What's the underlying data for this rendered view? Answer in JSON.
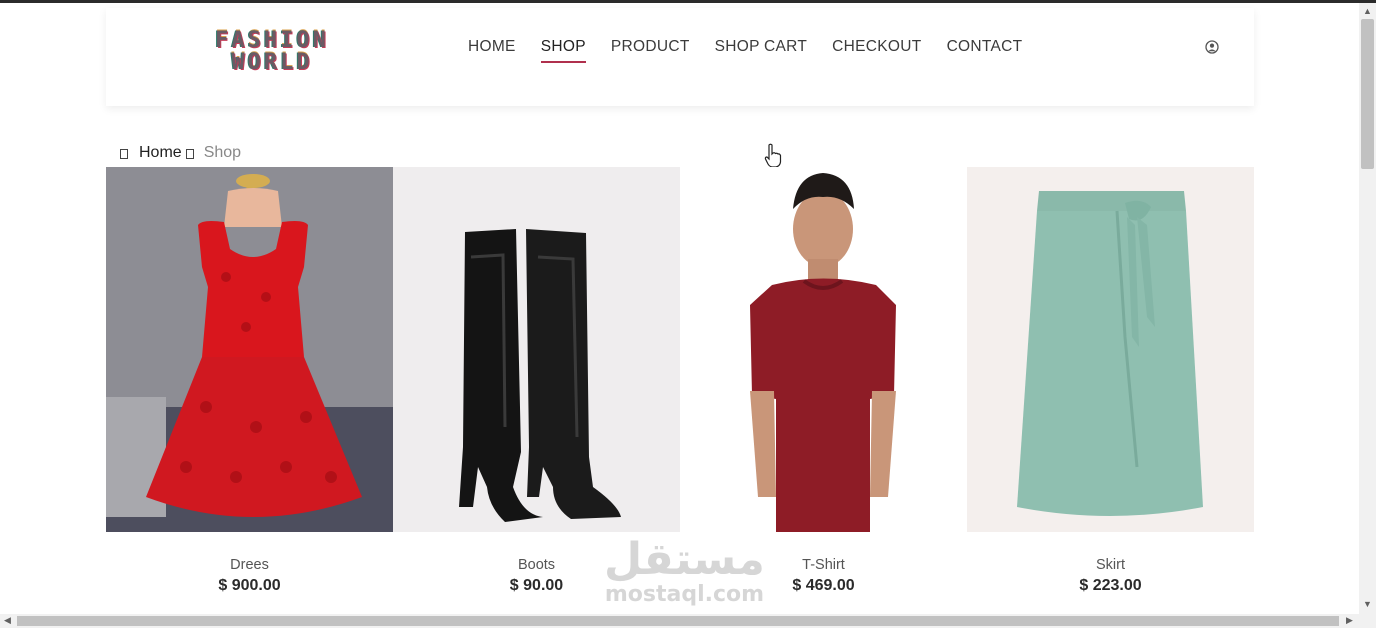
{
  "header": {
    "logo": {
      "line1": "FASHION",
      "line2": "WORLD"
    },
    "nav": [
      {
        "label": "HOME",
        "active": false
      },
      {
        "label": "SHOP",
        "active": true
      },
      {
        "label": "PRODUCT",
        "active": false
      },
      {
        "label": "SHOP CART",
        "active": false
      },
      {
        "label": "CHECKOUT",
        "active": false
      },
      {
        "label": "CONTACT",
        "active": false
      }
    ],
    "user_icon": "user-circle-icon"
  },
  "breadcrumb": {
    "home": "Home",
    "current": "Shop"
  },
  "products": [
    {
      "name": "Drees",
      "price": "$ 900.00",
      "image": "red-dress-image"
    },
    {
      "name": "Boots",
      "price": "$ 90.00",
      "image": "black-boots-image"
    },
    {
      "name": "T-Shirt",
      "price": "$ 469.00",
      "image": "red-tshirt-image"
    },
    {
      "name": "Skirt",
      "price": "$ 223.00",
      "image": "green-skirt-image"
    }
  ],
  "watermark": {
    "arabic": "مستقل",
    "latin": "mostaql.com"
  },
  "colors": {
    "accent": "#b0304d",
    "text": "#3b3b3b",
    "dress": "#d9161d",
    "tshirt": "#8e1c26",
    "skirt": "#8fbfb0"
  }
}
